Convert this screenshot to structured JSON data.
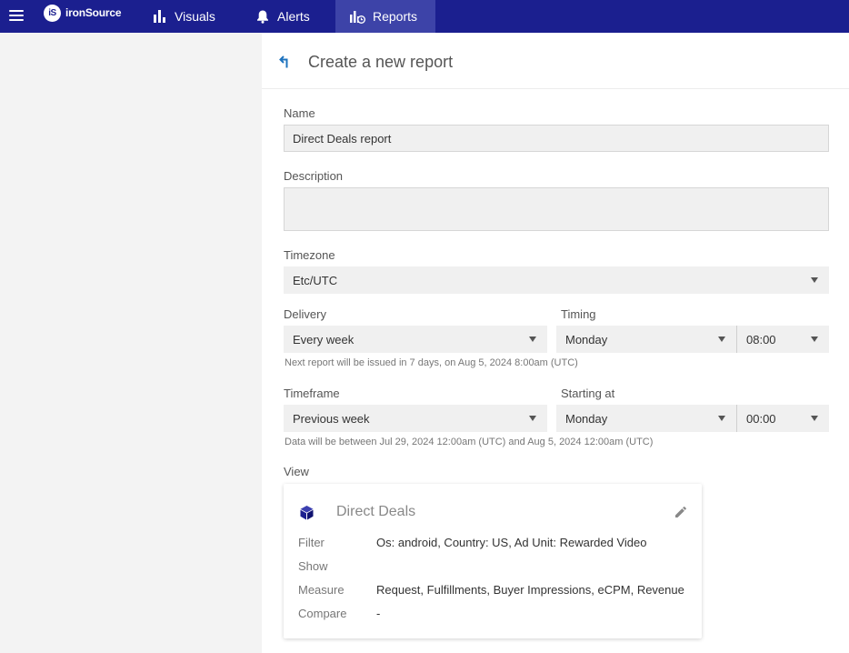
{
  "brand": {
    "mark": "iS",
    "name": "ironSource"
  },
  "nav": {
    "visuals": "Visuals",
    "alerts": "Alerts",
    "reports": "Reports"
  },
  "header": {
    "title": "Create a new report"
  },
  "form": {
    "name_label": "Name",
    "name_value": "Direct Deals report",
    "description_label": "Description",
    "description_value": "",
    "timezone_label": "Timezone",
    "timezone_value": "Etc/UTC",
    "delivery_label": "Delivery",
    "delivery_value": "Every week",
    "timing_label": "Timing",
    "timing_day": "Monday",
    "timing_time": "08:00",
    "delivery_hint": "Next report will be issued in 7 days, on Aug 5, 2024 8:00am (UTC)",
    "timeframe_label": "Timeframe",
    "timeframe_value": "Previous week",
    "starting_label": "Starting at",
    "starting_day": "Monday",
    "starting_time": "00:00",
    "timeframe_hint": "Data will be between Jul 29, 2024 12:00am (UTC) and Aug 5, 2024 12:00am (UTC)",
    "view_label": "View"
  },
  "view": {
    "title": "Direct Deals",
    "rows": [
      {
        "label": "Filter",
        "value": "Os: android, Country: US, Ad Unit: Rewarded Video"
      },
      {
        "label": "Show",
        "value": ""
      },
      {
        "label": "Measure",
        "value": "Request, Fulfillments, Buyer Impressions, eCPM, Revenue"
      },
      {
        "label": "Compare",
        "value": "-"
      }
    ]
  },
  "colors": {
    "topbar": "#1b1f8f",
    "active_tab": "#3d43a8",
    "accent": "#1e73be"
  },
  "icons": {
    "menu": "hamburger-icon",
    "visuals": "bar-chart-icon",
    "alerts": "bell-icon",
    "reports": "report-chart-icon",
    "back": "back-arrow-icon",
    "view": "cube-icon",
    "edit": "pencil-icon"
  }
}
